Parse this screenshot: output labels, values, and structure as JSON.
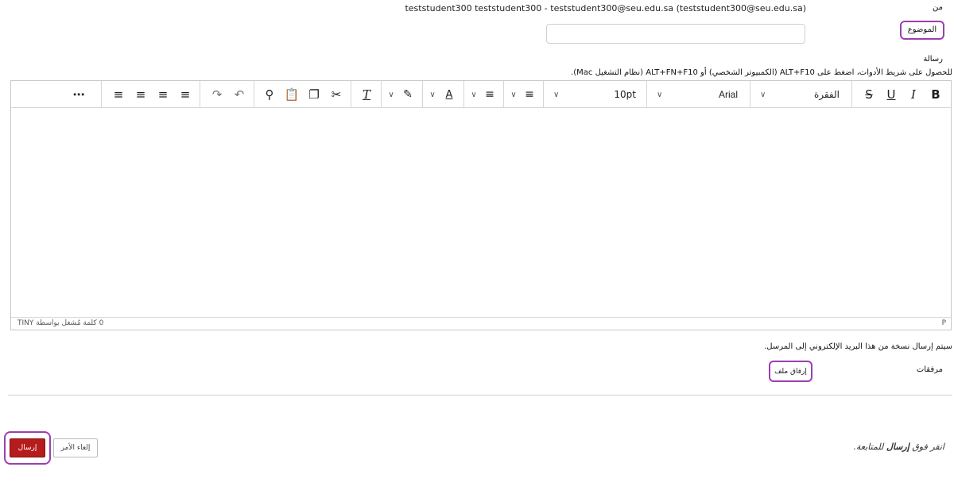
{
  "from": {
    "label": "من",
    "value": "teststudent300 teststudent300 - teststudent300@seu.edu.sa (teststudent300@seu.edu.sa)"
  },
  "subject": {
    "label": "الموضوع",
    "value": ""
  },
  "message": {
    "label": "رسالة",
    "toolbar_hint": "للحصول على شريط الأدوات، اضغط على ALT+F10 (الكمبيوتر الشخصي) أو ALT+FN+F10 (نظام التشغيل Mac)."
  },
  "editor": {
    "paragraph_format": "الفقرة",
    "font_family": "Arial",
    "font_size": "10pt",
    "content": "",
    "status_path": "P",
    "word_count": "0 كلمة",
    "powered_by": "مُشغل بواسطة TINY",
    "icons": [
      "bold-icon",
      "italic-icon",
      "underline-icon",
      "strikethrough-icon",
      "bullet-list-icon",
      "numbered-list-icon",
      "text-color-icon",
      "highlight-icon",
      "clear-formatting-icon",
      "cut-icon",
      "copy-icon",
      "paste-icon",
      "search-icon",
      "undo-icon",
      "redo-icon",
      "align-left-icon",
      "align-center-icon",
      "align-right-icon",
      "justify-icon",
      "more-icon"
    ]
  },
  "copy_note": "سيتم إرسال نسخة من هذا البريد الإلكتروني إلى المرسل.",
  "attachments": {
    "label": "مرفقات",
    "button": "إرفاق ملف"
  },
  "actions": {
    "send": "إرسال",
    "cancel": "إلغاء الأمر"
  },
  "continue_hint": {
    "prefix": "انقر فوق",
    "bold": "إرسال",
    "suffix": "للمتابعة."
  },
  "colors": {
    "accent_ring": "#9b3fb0",
    "send_button": "#b51c1c"
  }
}
